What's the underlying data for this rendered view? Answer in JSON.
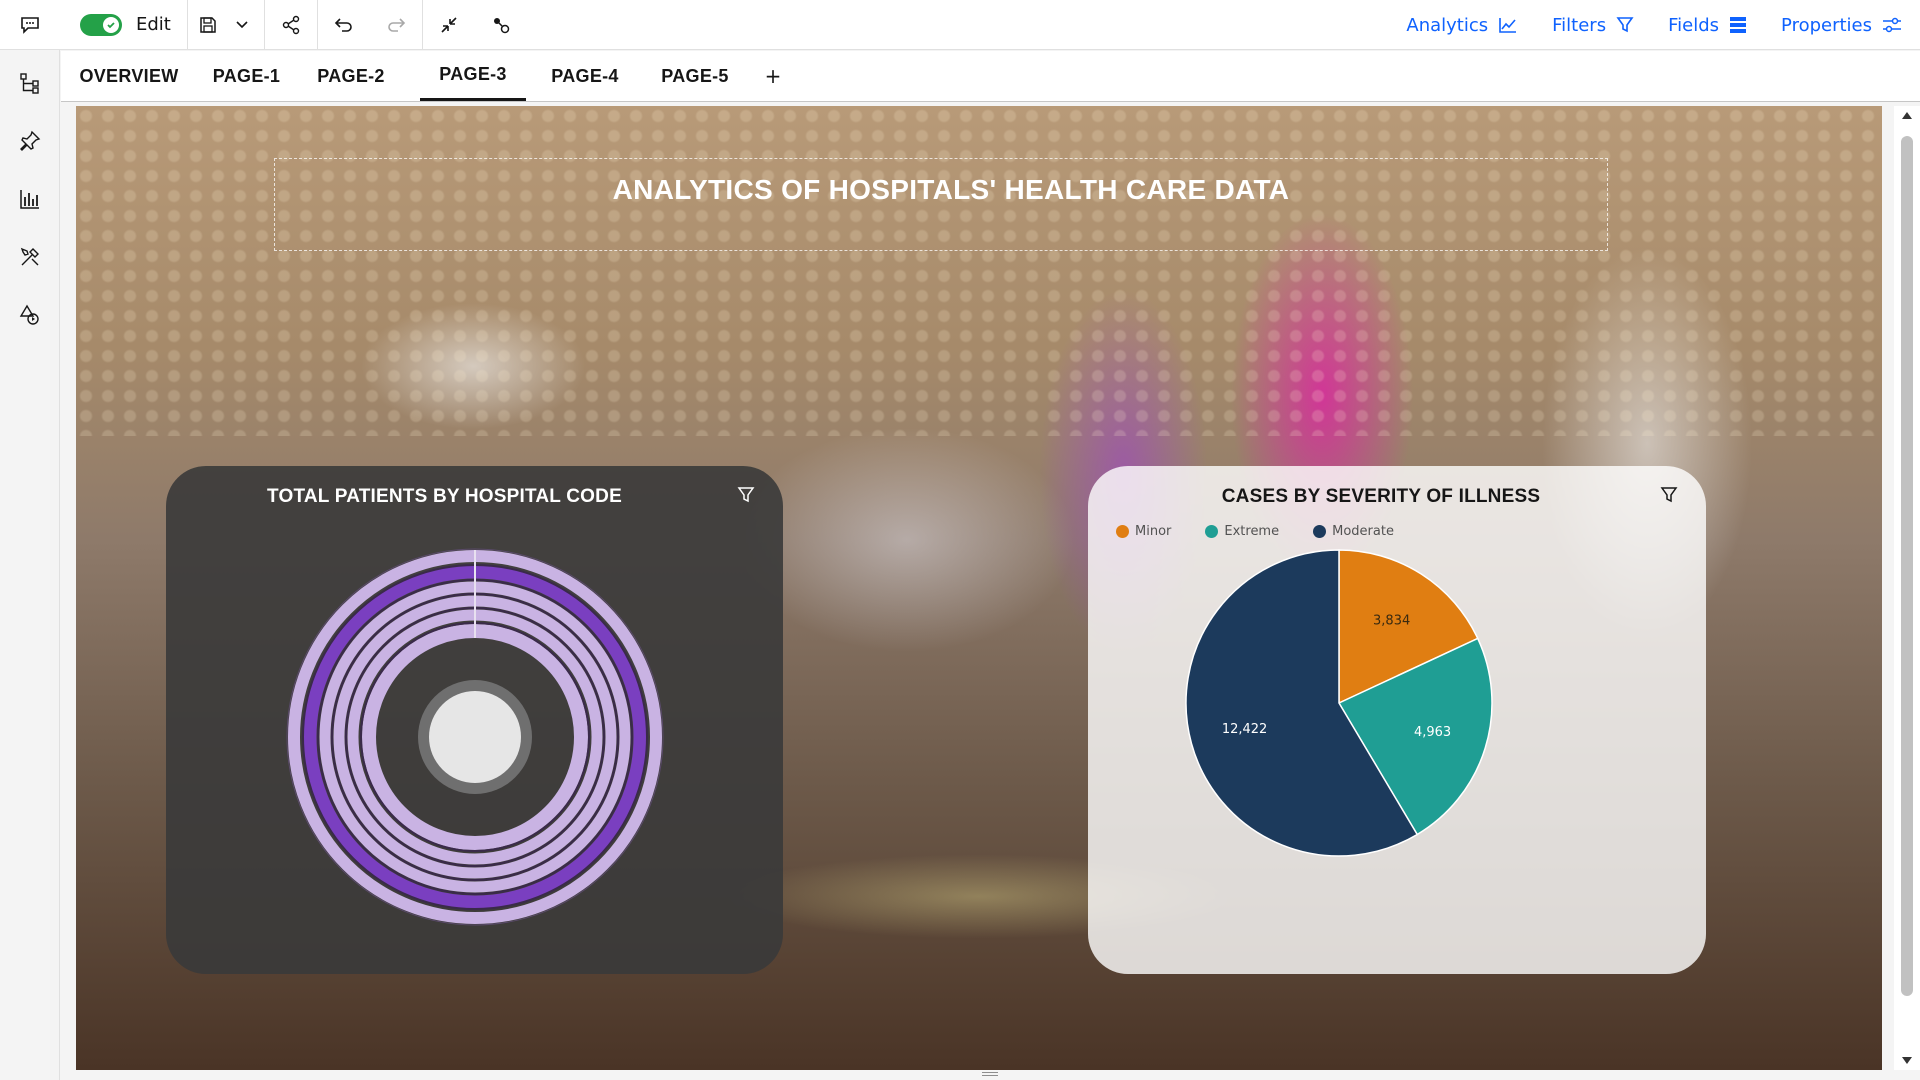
{
  "toolbar": {
    "edit_label": "Edit",
    "edit_on": true,
    "right_items": [
      {
        "label": "Analytics",
        "icon": "analytics-line-icon"
      },
      {
        "label": "Filters",
        "icon": "filter-icon"
      },
      {
        "label": "Fields",
        "icon": "fields-icon"
      },
      {
        "label": "Properties",
        "icon": "sliders-icon"
      }
    ]
  },
  "rail": {
    "icons": [
      "navigation-tree-icon",
      "pin-icon",
      "bar-chart-icon",
      "tools-icon",
      "shapes-play-icon"
    ]
  },
  "tabs": {
    "items": [
      "OVERVIEW",
      "PAGE-1",
      "PAGE-2",
      "PAGE-3",
      "PAGE-4",
      "PAGE-5"
    ],
    "active": "PAGE-3",
    "add_label": "+"
  },
  "canvas": {
    "title": "ANALYTICS OF HOSPITALS' HEALTH CARE DATA"
  },
  "widgets": {
    "left": {
      "title": "TOTAL PATIENTS BY HOSPITAL CODE"
    },
    "right": {
      "title": "CASES BY SEVERITY OF ILLNESS"
    }
  },
  "colors": {
    "accent": "#0f62fe",
    "toggle_on": "#24a148",
    "minor": "#e07e12",
    "extreme": "#1f9e94",
    "moderate": "#1c3a5c",
    "ring_purple_dark": "#7a3fc0",
    "ring_purple_light": "#c9b3e3"
  },
  "chart_data": [
    {
      "type": "radial-bar",
      "title": "TOTAL PATIENTS BY HOSPITAL CODE",
      "note": "concentric rings without visible labels",
      "rings": 6
    },
    {
      "type": "pie",
      "title": "CASES BY SEVERITY OF ILLNESS",
      "legend_position": "top-left",
      "series": [
        {
          "name": "Minor",
          "value": 3834,
          "label": "3,834"
        },
        {
          "name": "Extreme",
          "value": 4963,
          "label": "4,963"
        },
        {
          "name": "Moderate",
          "value": 12422,
          "label": "12,422"
        }
      ]
    }
  ]
}
